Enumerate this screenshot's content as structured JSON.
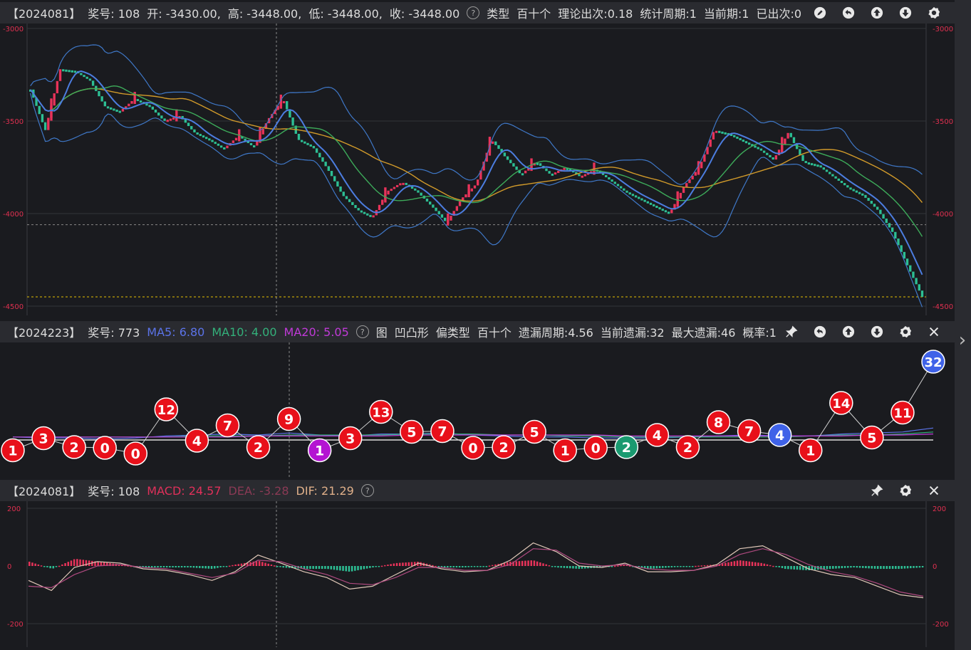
{
  "panel1": {
    "header": {
      "period": "【2024081】",
      "award": "奖号: 108",
      "open": "开: -3430.00,",
      "high": "高: -3448.00,",
      "low": "低: -3448.00,",
      "close": "收: -3448.00",
      "type_label": "类型",
      "pos_label": "百十个",
      "theory": "理论出次:0.18",
      "stat_period": "统计周期:1",
      "current_period": "当前期:1",
      "appeared": "已出次:0"
    },
    "icons": [
      "edit-icon",
      "undo-icon",
      "up-icon",
      "down-icon",
      "settings-icon"
    ]
  },
  "panel2": {
    "header": {
      "period": "【2024223】",
      "award": "奖号: 773",
      "ma5": "MA5: 6.80",
      "ma10": "MA10: 4.00",
      "ma20": "MA20: 5.05",
      "tag": "图",
      "shape": "凹凸形",
      "type": "偏类型",
      "pos": "百十个",
      "omit_period": "遗漏周期:4.56",
      "current_omit": "当前遗漏:32",
      "max_omit": "最大遗漏:46",
      "prob": "概率:1"
    },
    "icons": [
      "pin-icon",
      "undo-icon",
      "up-icon",
      "down-icon",
      "settings-icon",
      "close-icon"
    ]
  },
  "panel3": {
    "header": {
      "period": "【2024081】",
      "award": "奖号: 108",
      "macd": "MACD: 24.57",
      "dea": "DEA: ",
      "dea_value": "-3.28",
      "dif": "DIF: 21.29"
    },
    "icons": [
      "pin-icon",
      "settings-icon",
      "close-icon"
    ]
  },
  "colors": {
    "up": "#e8335a",
    "down": "#2dbf94",
    "ma5": "#4c7de0",
    "ma10": "#3dab5a",
    "ma20": "#d19a2a",
    "boll": "#3f78c8",
    "ma5_text": "#5b73e8",
    "ma10_text": "#33b07a",
    "ma20_text": "#c03ad8",
    "macd_text": "#e0305a",
    "dea_text": "#8a3a55",
    "dif_text": "#e0b08a",
    "ball_red": "#e8101a",
    "ball_purple": "#b414d2",
    "ball_green": "#1a9a70",
    "ball_blue": "#3f62e8"
  },
  "chart_data": [
    {
      "type": "candlestick",
      "title": "",
      "yticks": [
        -3000,
        -3500,
        -4000,
        -4500
      ],
      "ylim": [
        -4500,
        -3000
      ],
      "reference_lines": [
        -4060,
        -4450
      ],
      "trend": [
        -3330,
        -3550,
        -3220,
        -3230,
        -3280,
        -3420,
        -3450,
        -3380,
        -3420,
        -3500,
        -3470,
        -3560,
        -3600,
        -3650,
        -3580,
        -3640,
        -3490,
        -3380,
        -3600,
        -3640,
        -3760,
        -3900,
        -3980,
        -4020,
        -3880,
        -3830,
        -3880,
        -3960,
        -4050,
        -3920,
        -3840,
        -3600,
        -3700,
        -3790,
        -3720,
        -3790,
        -3750,
        -3800,
        -3760,
        -3820,
        -3880,
        -3920,
        -3960,
        -4000,
        -3850,
        -3750,
        -3550,
        -3570,
        -3610,
        -3650,
        -3710,
        -3560,
        -3720,
        -3740,
        -3800,
        -3860,
        -3900,
        -3980,
        -4100,
        -4280,
        -4450
      ]
    },
    {
      "type": "scatter",
      "title": "",
      "values": [
        1,
        3,
        2,
        0,
        0,
        12,
        4,
        7,
        2,
        9,
        1,
        3,
        13,
        5,
        7,
        0,
        2,
        5,
        1,
        0,
        2,
        4,
        2,
        8,
        7,
        4,
        1,
        14,
        5,
        11,
        32
      ],
      "ball_colors": [
        "red",
        "red",
        "red",
        "red",
        "red",
        "red",
        "red",
        "red",
        "red",
        "red",
        "purple",
        "red",
        "red",
        "red",
        "red",
        "red",
        "red",
        "red",
        "red",
        "red",
        "green",
        "red",
        "red",
        "red",
        "red",
        "blue",
        "red",
        "red",
        "red",
        "red",
        "blue"
      ],
      "series": [
        {
          "name": "MA5",
          "values": [
            3,
            2,
            2,
            1,
            2,
            4,
            5,
            6,
            5,
            7,
            5,
            4,
            6,
            6,
            7,
            5,
            4,
            3,
            3,
            2,
            2,
            2,
            3,
            4,
            5,
            4,
            4,
            6,
            7,
            8,
            12
          ]
        },
        {
          "name": "MA10",
          "values": [
            3,
            3,
            3,
            3,
            3,
            3,
            4,
            4,
            4,
            5,
            5,
            5,
            5,
            6,
            6,
            6,
            5,
            5,
            4,
            4,
            3,
            3,
            3,
            3,
            3,
            3,
            4,
            5,
            5,
            6,
            8
          ]
        },
        {
          "name": "MA20",
          "values": [
            3,
            3,
            3,
            3,
            3,
            3,
            3,
            3,
            4,
            4,
            4,
            4,
            4,
            5,
            5,
            5,
            5,
            5,
            5,
            5,
            4,
            4,
            4,
            4,
            4,
            4,
            4,
            4,
            5,
            5,
            6
          ]
        }
      ],
      "ylim": [
        0,
        32
      ]
    },
    {
      "type": "line",
      "title": "",
      "yticks": [
        200,
        0,
        -200
      ],
      "ylim": [
        -200,
        200
      ],
      "series": [
        {
          "name": "DIF",
          "values": [
            -50,
            -85,
            -5,
            15,
            10,
            -10,
            -15,
            -30,
            -50,
            -20,
            38,
            10,
            -20,
            -40,
            -80,
            -70,
            -30,
            10,
            -10,
            -20,
            -15,
            20,
            80,
            50,
            0,
            -5,
            10,
            -20,
            -20,
            -15,
            5,
            60,
            70,
            30,
            -10,
            -30,
            -40,
            -70,
            -100,
            -110
          ]
        },
        {
          "name": "DEA",
          "values": [
            -70,
            -75,
            -30,
            0,
            5,
            -5,
            -10,
            -25,
            -40,
            -25,
            20,
            15,
            -10,
            -30,
            -60,
            -65,
            -40,
            -5,
            -5,
            -15,
            -15,
            5,
            60,
            55,
            10,
            0,
            5,
            -10,
            -15,
            -15,
            0,
            40,
            60,
            40,
            5,
            -20,
            -35,
            -60,
            -90,
            -105
          ]
        }
      ],
      "histogram": [
        15,
        -10,
        25,
        15,
        5,
        -5,
        -5,
        -5,
        -10,
        5,
        18,
        -5,
        -10,
        -10,
        -20,
        -5,
        10,
        15,
        -5,
        -5,
        0,
        15,
        20,
        -5,
        -10,
        -5,
        5,
        -10,
        -5,
        0,
        5,
        20,
        10,
        -10,
        -15,
        -10,
        -5,
        -10,
        -10,
        -5
      ]
    }
  ]
}
